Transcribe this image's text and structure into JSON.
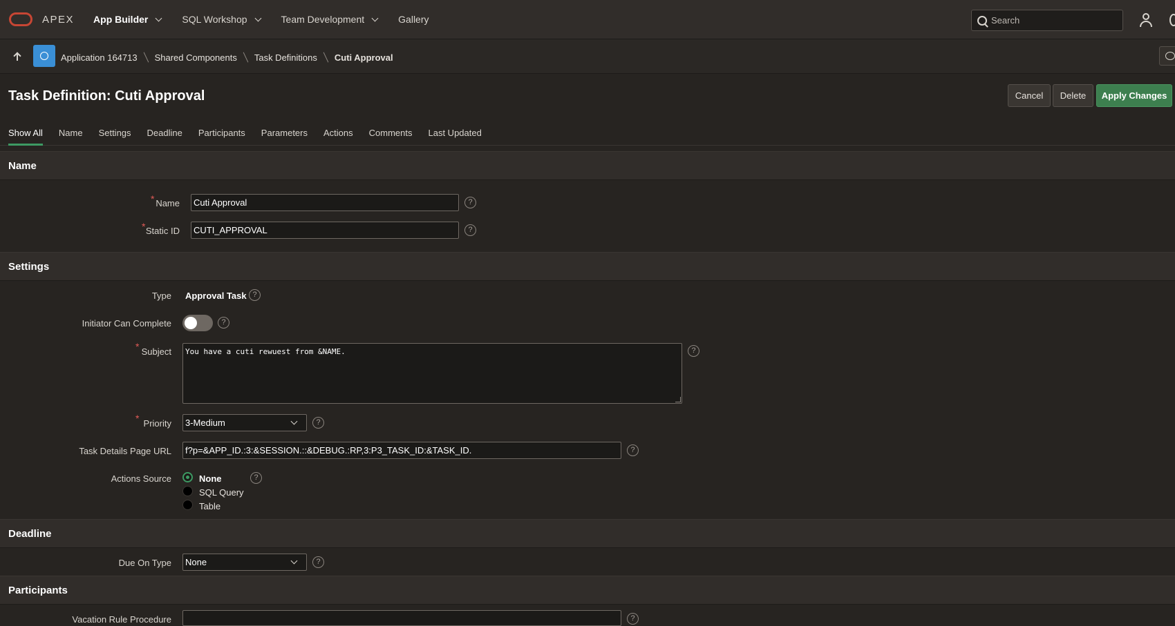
{
  "topnav": {
    "brand": "APEX",
    "items": [
      {
        "label": "App Builder"
      },
      {
        "label": "SQL Workshop"
      },
      {
        "label": "Team Development"
      },
      {
        "label": "Gallery"
      }
    ],
    "search_placeholder": "Search"
  },
  "breadcrumb": {
    "items": [
      "Application 164713",
      "Shared Components",
      "Task Definitions",
      "Cuti Approval"
    ]
  },
  "header": {
    "title": "Task Definition: Cuti Approval",
    "cancel_label": "Cancel",
    "delete_label": "Delete",
    "apply_label": "Apply Changes"
  },
  "tabs": [
    "Show All",
    "Name",
    "Settings",
    "Deadline",
    "Participants",
    "Parameters",
    "Actions",
    "Comments",
    "Last Updated"
  ],
  "sections": {
    "name": {
      "title": "Name",
      "name_label": "Name",
      "name_value": "Cuti Approval",
      "static_id_label": "Static ID",
      "static_id_value": "CUTI_APPROVAL"
    },
    "settings": {
      "title": "Settings",
      "type_label": "Type",
      "type_value": "Approval Task",
      "initiator_label": "Initiator Can Complete",
      "subject_label": "Subject",
      "subject_value": "You have a cuti rewuest from &NAME.",
      "priority_label": "Priority",
      "priority_value": "3-Medium",
      "task_url_label": "Task Details Page URL",
      "task_url_value": "f?p=&APP_ID.:3:&SESSION.::&DEBUG.:RP,3:P3_TASK_ID:&TASK_ID.",
      "actions_source_label": "Actions Source",
      "actions_source_options": [
        "None",
        "SQL Query",
        "Table"
      ]
    },
    "deadline": {
      "title": "Deadline",
      "due_on_type_label": "Due On Type",
      "due_on_type_value": "None"
    },
    "participants": {
      "title": "Participants",
      "vacation_label": "Vacation Rule Procedure",
      "vacation_value": ""
    }
  },
  "help_glyph": "?",
  "required_glyph": "*",
  "colors": {
    "accent_green": "#3d7f4f",
    "required_red": "#e25b57",
    "app_icon_blue": "#3a8fd6"
  }
}
